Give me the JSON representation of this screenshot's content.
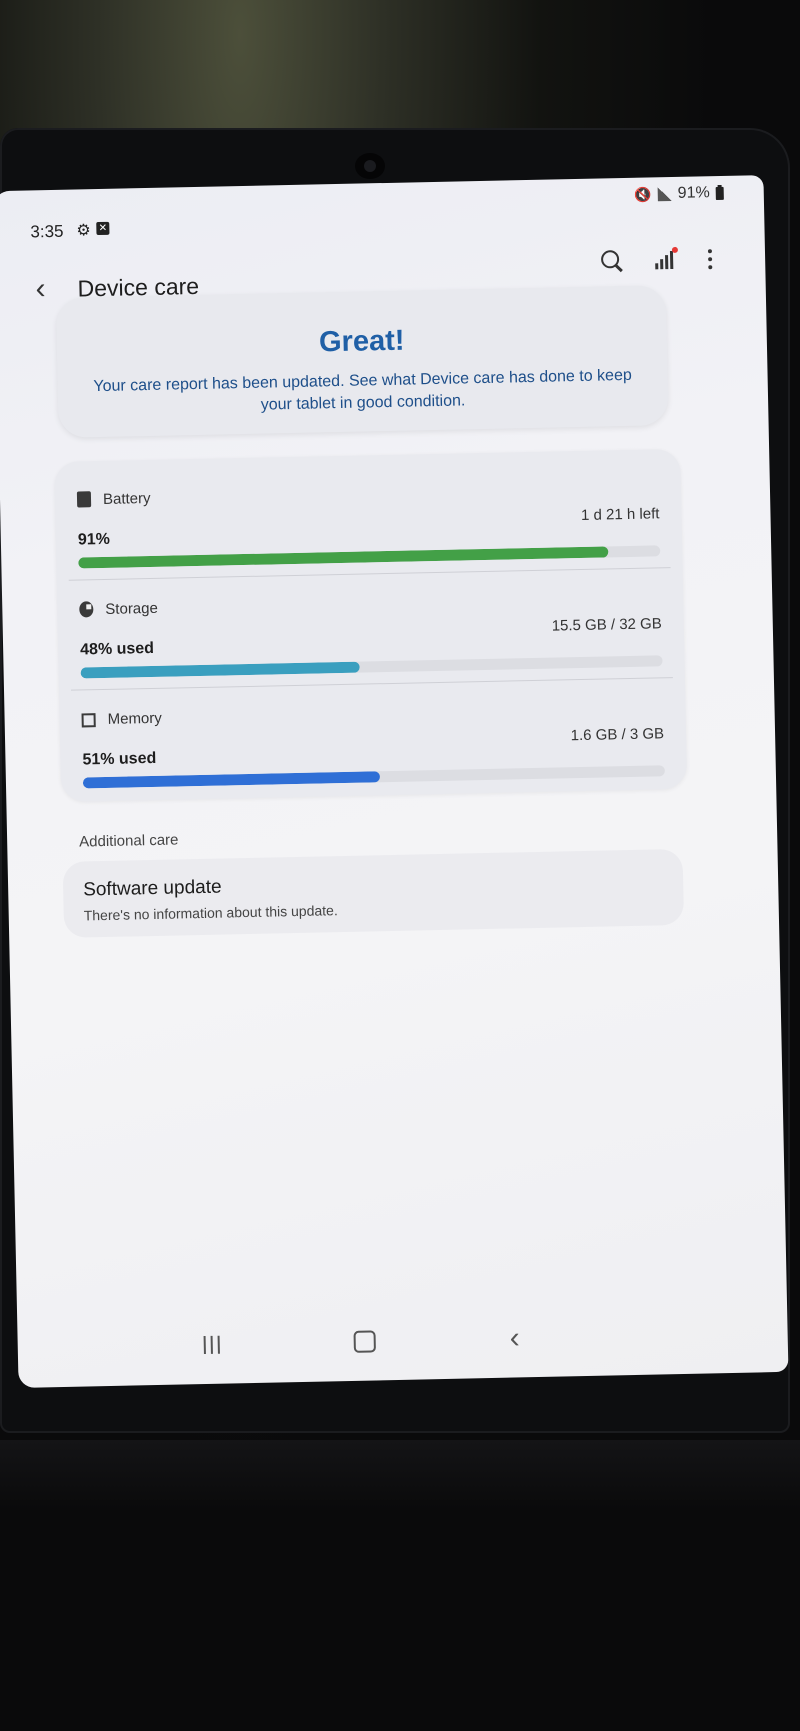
{
  "status_bar": {
    "time": "3:35",
    "battery_percent": "91%"
  },
  "header": {
    "title": "Device care"
  },
  "banner": {
    "title": "Great!",
    "text": "Your care report has been updated. See what Device care has done to keep your tablet in good condition."
  },
  "resources": {
    "battery": {
      "label": "Battery",
      "value": "91%",
      "detail": "1 d 21 h left",
      "level": 0.91,
      "color": "#43a047"
    },
    "storage": {
      "label": "Storage",
      "value": "48% used",
      "detail": "15.5 GB / 32 GB",
      "level": 0.48,
      "color": "#3a9fbf"
    },
    "memory": {
      "label": "Memory",
      "value": "51% used",
      "detail": "1.6 GB / 3 GB",
      "level": 0.51,
      "color": "#2f6fd6"
    }
  },
  "additional_care": {
    "section_title": "Additional care",
    "software_update": {
      "title": "Software update",
      "subtitle": "There's no information about this update."
    }
  },
  "icons": {
    "back": "back-arrow-icon",
    "search": "search-icon",
    "report": "bars-chart-icon",
    "more": "more-options-icon",
    "battery": "battery-icon",
    "storage": "storage-icon",
    "memory": "memory-chip-icon"
  }
}
